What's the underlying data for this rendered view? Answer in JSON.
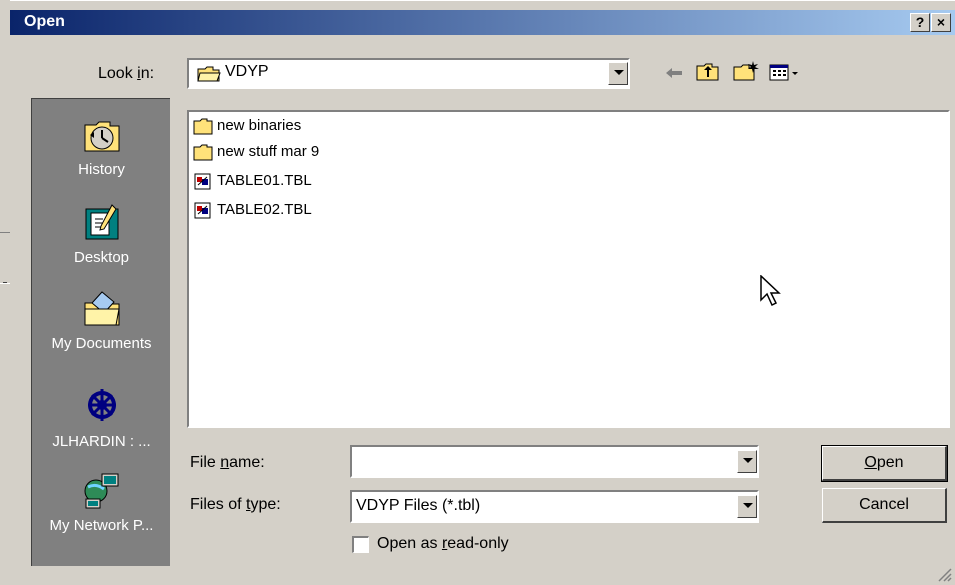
{
  "dialog": {
    "title": "Open",
    "help_button": "?",
    "close_button": "×"
  },
  "look_in": {
    "label_pre": "Look ",
    "label_accel": "i",
    "label_post": "n:",
    "value": "VDYP"
  },
  "toolbar": {
    "icons": [
      "back-arrow-icon",
      "up-folder-icon",
      "new-folder-icon",
      "view-menu-icon"
    ]
  },
  "places": [
    {
      "label": "History",
      "icon": "history-icon"
    },
    {
      "label": "Desktop",
      "icon": "desktop-icon"
    },
    {
      "label": "My Documents",
      "icon": "my-documents-icon"
    },
    {
      "label": "JLHARDIN : ...",
      "icon": "network-drive-icon"
    },
    {
      "label": "My Network P...",
      "icon": "network-places-icon"
    }
  ],
  "files": [
    {
      "name": "new binaries",
      "type": "folder"
    },
    {
      "name": "new stuff mar 9",
      "type": "folder"
    },
    {
      "name": "TABLE01.TBL",
      "type": "file"
    },
    {
      "name": "TABLE02.TBL",
      "type": "file"
    }
  ],
  "file_name": {
    "label_pre": "File ",
    "label_accel": "n",
    "label_post": "ame:",
    "value": ""
  },
  "file_type": {
    "label_pre": "Files of ",
    "label_accel": "t",
    "label_post": "ype:",
    "value": "VDYP Files (*.tbl)"
  },
  "read_only": {
    "label_pre": "Open as ",
    "label_accel": "r",
    "label_post": "ead-only",
    "checked": false
  },
  "buttons": {
    "open_accel": "O",
    "open_rest": "pen",
    "cancel": "Cancel"
  }
}
